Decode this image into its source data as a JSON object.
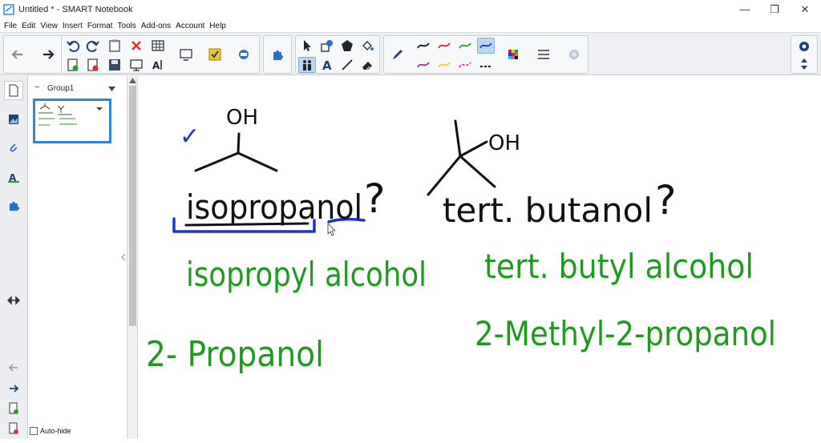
{
  "window": {
    "title": "Untitled * - SMART Notebook",
    "minimize": "—",
    "maximize": "❐",
    "close": "✕"
  },
  "menu": [
    "File",
    "Edit",
    "View",
    "Insert",
    "Format",
    "Tools",
    "Add-ons",
    "Account",
    "Help"
  ],
  "page_panel": {
    "group_label": "Group1",
    "collapse": "−",
    "auto_hide_label": "Auto-hide"
  },
  "canvas": {
    "checkmark": "✓",
    "oh_left": "OH",
    "oh_right": "OH",
    "name1": "isopropanol",
    "name2": "tert. butanol",
    "q": "?",
    "alt1a": "isopropyl alcohol",
    "alt1b": "2- Propanol",
    "alt2a": "tert. butyl alcohol",
    "alt2b": "2-Methyl-2-propanol"
  },
  "colors": {
    "ink_black": "#111111",
    "ink_blue": "#1a33d6",
    "ink_green": "#1f9a1f",
    "accent": "#2f86d6"
  }
}
